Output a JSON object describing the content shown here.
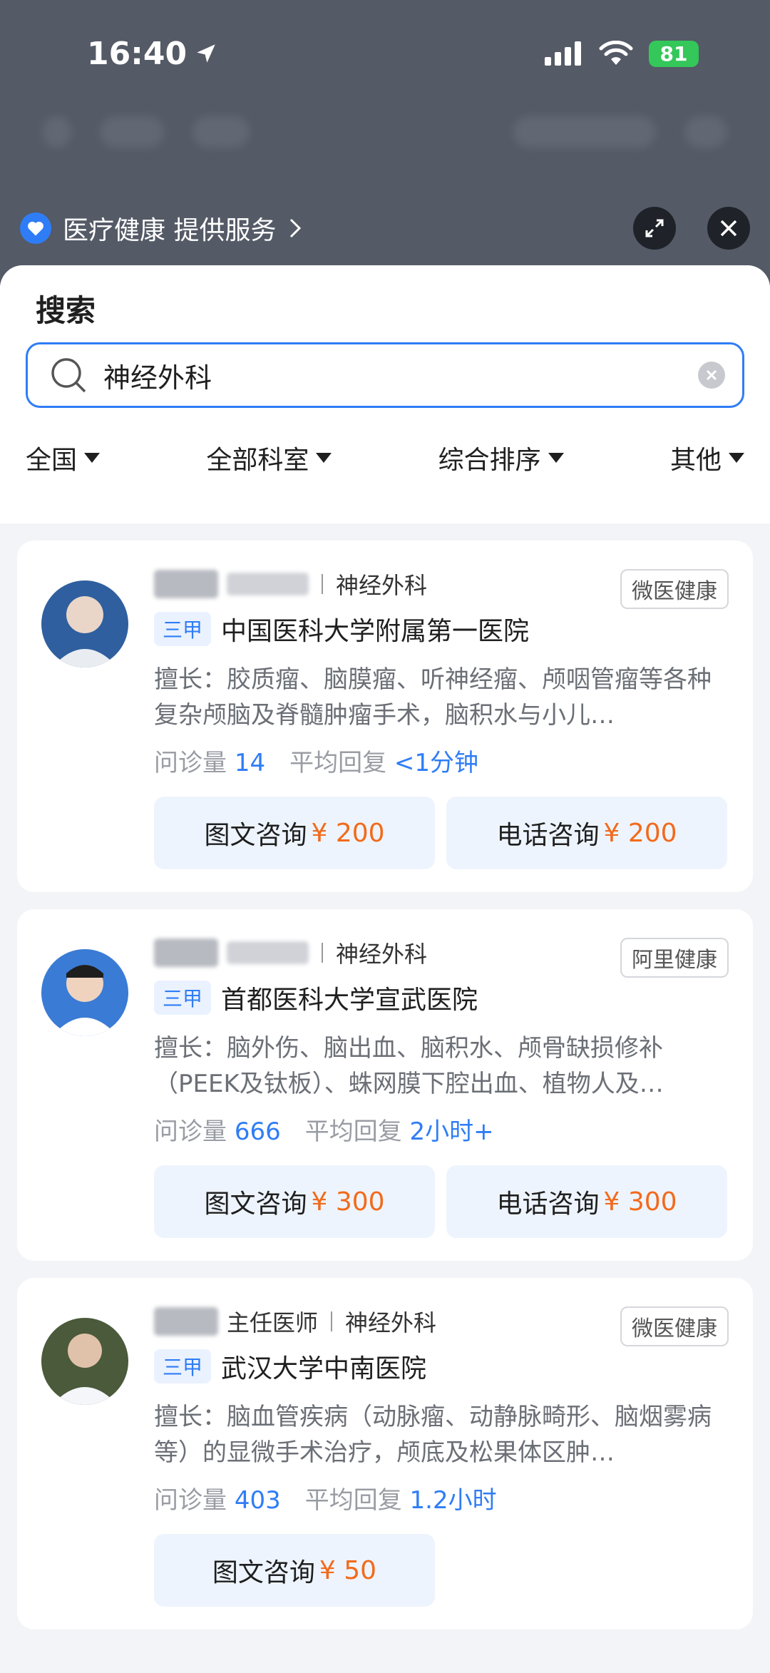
{
  "status_bar": {
    "time": "16:40",
    "battery": "81"
  },
  "service": {
    "label": "医疗健康 提供服务"
  },
  "sheet": {
    "title": "搜索",
    "search": {
      "value": "神经外科"
    },
    "filters": [
      "全国",
      "全部科室",
      "综合排序",
      "其他"
    ]
  },
  "doctors": [
    {
      "title": "",
      "dept": "神经外科",
      "source": "微医健康",
      "level": "三甲",
      "hospital": "中国医科大学附属第一医院",
      "expertise": "擅长：胶质瘤、脑膜瘤、听神经瘤、颅咽管瘤等各种复杂颅脑及脊髓肿瘤手术，脑积水与小儿…",
      "consult_label": "问诊量",
      "consult_count": "14",
      "reply_label": "平均回复",
      "reply_time": "<1分钟",
      "buttons": [
        {
          "label": "图文咨询",
          "price": "¥ 200"
        },
        {
          "label": "电话咨询",
          "price": "¥ 200"
        }
      ],
      "avatar_color": "#2f5f9e"
    },
    {
      "title": "",
      "dept": "神经外科",
      "source": "阿里健康",
      "level": "三甲",
      "hospital": "首都医科大学宣武医院",
      "expertise": "擅长：脑外伤、脑出血、脑积水、颅骨缺损修补（PEEK及钛板）、蛛网膜下腔出血、植物人及…",
      "consult_label": "问诊量",
      "consult_count": "666",
      "reply_label": "平均回复",
      "reply_time": "2小时+",
      "buttons": [
        {
          "label": "图文咨询",
          "price": "¥ 300"
        },
        {
          "label": "电话咨询",
          "price": "¥ 300"
        }
      ],
      "avatar_color": "#3a7bd5"
    },
    {
      "title": "主任医师",
      "dept": "神经外科",
      "source": "微医健康",
      "level": "三甲",
      "hospital": "武汉大学中南医院",
      "expertise": "擅长：脑血管疾病（动脉瘤、动静脉畸形、脑烟雾病等）的显微手术治疗，颅底及松果体区肿…",
      "consult_label": "问诊量",
      "consult_count": "403",
      "reply_label": "平均回复",
      "reply_time": "1.2小时",
      "buttons": [
        {
          "label": "图文咨询",
          "price": "¥ 50"
        }
      ],
      "avatar_color": "#4a5a3a"
    }
  ]
}
